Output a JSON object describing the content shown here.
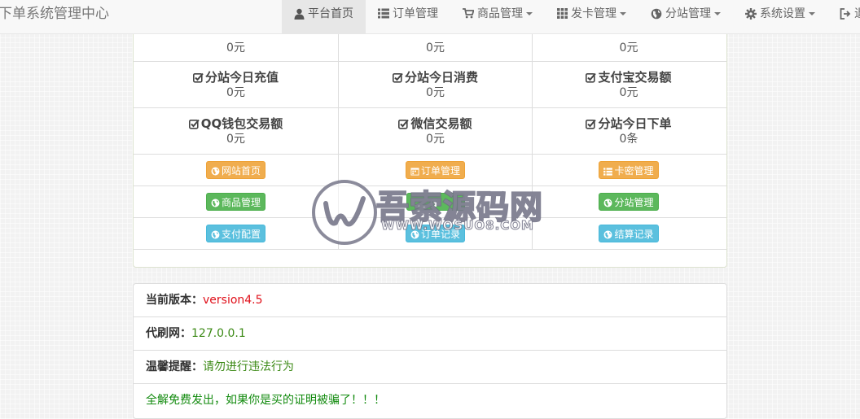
{
  "navbar": {
    "brand": "下单系统管理中心",
    "items": [
      {
        "label": "平台首页",
        "icon": "user-icon",
        "active": true,
        "dropdown": false
      },
      {
        "label": "订单管理",
        "icon": "list-icon",
        "active": false,
        "dropdown": false
      },
      {
        "label": "商品管理",
        "icon": "cart-icon",
        "active": false,
        "dropdown": true
      },
      {
        "label": "发卡管理",
        "icon": "grid-icon",
        "active": false,
        "dropdown": true
      },
      {
        "label": "分站管理",
        "icon": "globe-icon",
        "active": false,
        "dropdown": true
      },
      {
        "label": "系统设置",
        "icon": "gear-icon",
        "active": false,
        "dropdown": true
      },
      {
        "label": "退",
        "icon": "logout-icon",
        "active": false,
        "dropdown": false
      }
    ]
  },
  "stats": {
    "row0": [
      {
        "label": "",
        "value": "0元"
      },
      {
        "label": "",
        "value": "0元"
      },
      {
        "label": "",
        "value": "0元"
      }
    ],
    "row1": [
      {
        "label": "分站今日充值",
        "value": "0元"
      },
      {
        "label": "分站今日消费",
        "value": "0元"
      },
      {
        "label": "支付宝交易额",
        "value": "0元"
      }
    ],
    "row2": [
      {
        "label": "QQ钱包交易额",
        "value": "0元"
      },
      {
        "label": "微信交易额",
        "value": "0元"
      },
      {
        "label": "分站今日下单",
        "value": "0条"
      }
    ]
  },
  "buttons": {
    "row1": [
      {
        "label": "网站首页",
        "icon": "globe-icon",
        "color": "#f0ad4e"
      },
      {
        "label": "订单管理",
        "icon": "calendar-icon",
        "color": "#f0ad4e"
      },
      {
        "label": "卡密管理",
        "icon": "list-icon",
        "color": "#f0ad4e"
      }
    ],
    "row2": [
      {
        "label": "商品管理",
        "icon": "globe-icon",
        "color": "#5cb85c"
      },
      {
        "label": "",
        "icon": "globe-icon",
        "color": "#5cb85c"
      },
      {
        "label": "分站管理",
        "icon": "globe-icon",
        "color": "#5cb85c"
      }
    ],
    "row3": [
      {
        "label": "支付配置",
        "icon": "globe-icon",
        "color": "#5bc0de"
      },
      {
        "label": "订单记录",
        "icon": "globe-icon",
        "color": "#5bc0de"
      },
      {
        "label": "结算记录",
        "icon": "globe-icon",
        "color": "#5bc0de"
      }
    ]
  },
  "info": {
    "version_label": "当前版本：",
    "version_value": "version4.5",
    "site_label": "代刷网：",
    "site_value": "127.0.0.1",
    "tip_label": "温馨提醒：",
    "tip_value": "请勿进行违法行为",
    "notice": "全解免费发出，如果你是买的证明被骗了！！！"
  },
  "watermark": {
    "title": "吾索源码网",
    "subtitle": "WWW.WOSUO8.COM"
  }
}
